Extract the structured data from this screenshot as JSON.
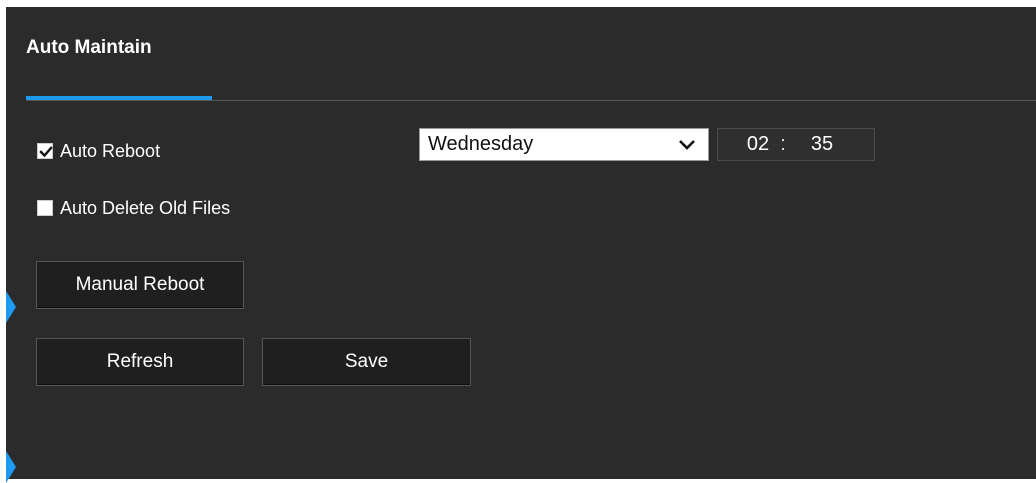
{
  "header": {
    "title": "Auto Maintain"
  },
  "auto_reboot": {
    "label": "Auto Reboot",
    "checked": true,
    "day": "Wednesday",
    "time_hour": "02",
    "time_separator": ":",
    "time_minute": "35"
  },
  "auto_delete": {
    "label": "Auto Delete Old Files",
    "checked": false
  },
  "buttons": {
    "manual_reboot": "Manual Reboot",
    "refresh": "Refresh",
    "save": "Save"
  },
  "icons": {
    "checkbox_check": "check-icon",
    "select_chevron": "chevron-down-icon",
    "side_arrow": "side-arrow-icon"
  },
  "colors": {
    "background": "#2b2b2b",
    "accent": "#1e9bf0",
    "button": "#1f1f1f",
    "text": "#ffffff"
  }
}
